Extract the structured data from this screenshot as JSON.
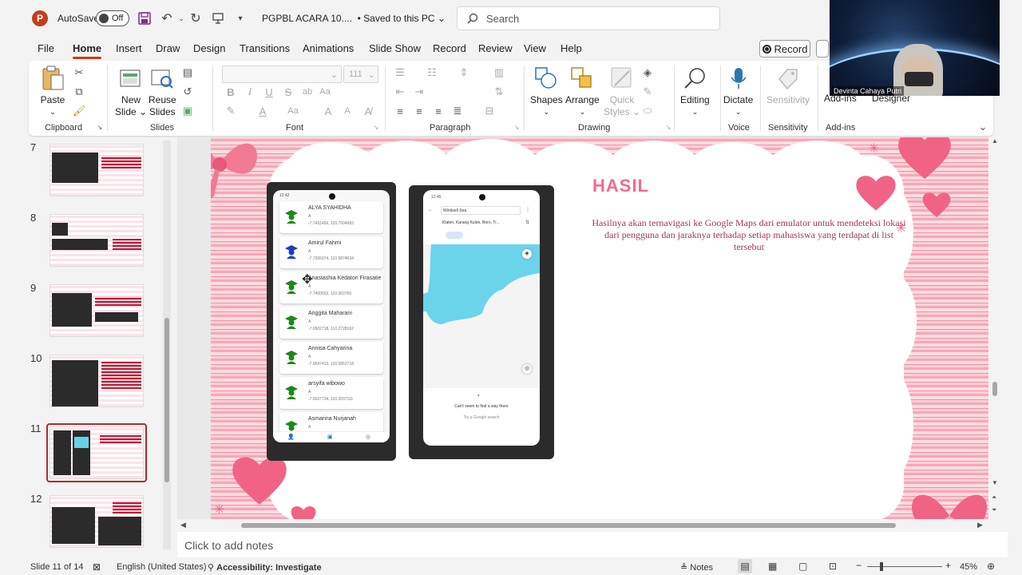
{
  "titlebar": {
    "app_logo": "P",
    "autosave_label": "AutoSave",
    "autosave_state": "Off",
    "filename": "PGPBL ACARA 10....",
    "save_state": "• Saved to this PC",
    "search_placeholder": "Search"
  },
  "menu": {
    "tabs": [
      "File",
      "Home",
      "Insert",
      "Draw",
      "Design",
      "Transitions",
      "Animations",
      "Slide Show",
      "Record",
      "Review",
      "View",
      "Help"
    ],
    "active": "Home",
    "record_label": "Record"
  },
  "ribbon": {
    "clipboard": {
      "label": "Clipboard",
      "paste": "Paste"
    },
    "slides": {
      "label": "Slides",
      "new_slide_1": "New",
      "new_slide_2": "Slide",
      "reuse_1": "Reuse",
      "reuse_2": "Slides"
    },
    "font": {
      "label": "Font",
      "size": "111"
    },
    "paragraph": {
      "label": "Paragraph"
    },
    "drawing": {
      "label": "Drawing",
      "shapes": "Shapes",
      "arrange": "Arrange",
      "quick_styles_1": "Quick",
      "quick_styles_2": "Styles"
    },
    "editing": {
      "label": "Editing"
    },
    "voice": {
      "label": "Voice",
      "dictate": "Dictate"
    },
    "sensitivity": {
      "label": "Sensitivity",
      "button": "Sensitivity"
    },
    "addins": {
      "label": "Add-ins",
      "button": "Add-ins",
      "designer": "Designer"
    }
  },
  "webcam": {
    "name": "Devinta Cahaya Putri"
  },
  "thumbnails": {
    "numbers": [
      "7",
      "8",
      "9",
      "10",
      "11",
      "12"
    ],
    "selected": "11"
  },
  "slide": {
    "title": "HASIL",
    "description": "Hasilnya akan ternavigasi ke Google Maps dari emulator untuk mendeteksi lokasi dari pengguna dan jaraknya terhadap setiap mahasiswa yang terdapat di list tersebut",
    "phone1": {
      "time": "12:42",
      "contacts": [
        {
          "name": "ALYA SYAHIDHA",
          "sub": "A",
          "coord": "-7.7431456, 110.7004983"
        },
        {
          "name": "Amirul Fahmi",
          "sub": "A",
          "coord": "-7.7265974, 110.5874634"
        },
        {
          "name": "Anastashia Kedaton Firasatie",
          "sub": "A",
          "coord": "-7.7400553, 110.363765"
        },
        {
          "name": "Anggita Maharani",
          "sub": "A",
          "coord": "-7.6502718, 110.2728162"
        },
        {
          "name": "Annisa Cahyarina",
          "sub": "A",
          "coord": "-7.8547413, 110.5852718"
        },
        {
          "name": "arsyifa wibowo",
          "sub": "A",
          "coord": "-7.6637734, 110.3037111"
        },
        {
          "name": "Asmarina Nurjanah",
          "sub": "A",
          "coord": ""
        }
      ]
    },
    "phone2": {
      "time": "12:45",
      "from": "Windsell Sea",
      "to": "Klaten, Karang Kulon, Boro, Tr...",
      "error": "Can't seem to find a way there",
      "hint": "Try a Google search"
    }
  },
  "notes": {
    "placeholder": "Click to add notes"
  },
  "status": {
    "slide_info": "Slide 11 of 14",
    "language": "English (United States)",
    "accessibility": "Accessibility: Investigate",
    "notes_btn": "Notes",
    "zoom": "45%"
  },
  "colors": {
    "accent": "#c43e1c",
    "selected_thumb": "#b3282d",
    "slide_title": "#f26b8a",
    "slide_text": "#a7384d"
  }
}
